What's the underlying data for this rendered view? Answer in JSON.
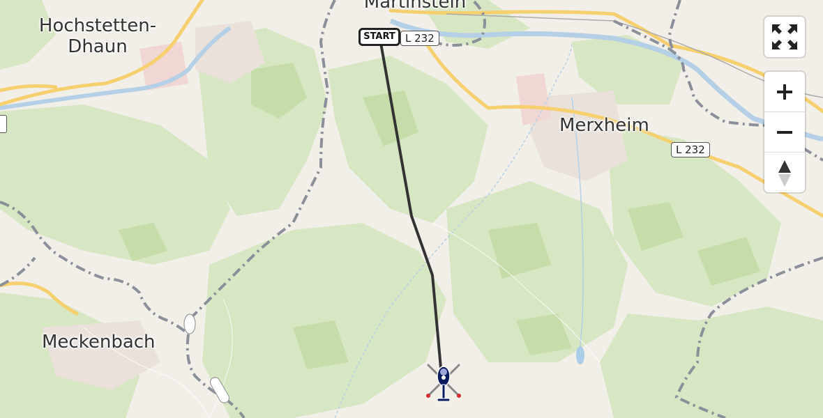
{
  "map": {
    "places": [
      {
        "id": "hochstetten",
        "name": "Hochstetten-\nDhaun"
      },
      {
        "id": "martinstein",
        "name": "Martinstein"
      },
      {
        "id": "merxheim",
        "name": "Merxheim"
      },
      {
        "id": "meckenbach",
        "name": "Meckenbach"
      }
    ],
    "road_shields": [
      {
        "label": "L 232"
      },
      {
        "label": "L 232"
      }
    ],
    "route": {
      "start_label": "START",
      "color": "#333333",
      "destination_icon": "helicopter-icon"
    },
    "colors": {
      "background": "#f2efe9",
      "forest": "#d6e6c0",
      "forest_dark": "#c5dca8",
      "road_major": "#f6cf6f",
      "river": "#b5d0e6",
      "border": "#8a8f99",
      "helicopter": "#0b1a5c"
    }
  },
  "controls": {
    "fullscreen_icon": "fullscreen-icon",
    "zoom_in_icon": "plus-icon",
    "zoom_out_icon": "minus-icon",
    "compass_icon": "compass-icon"
  }
}
